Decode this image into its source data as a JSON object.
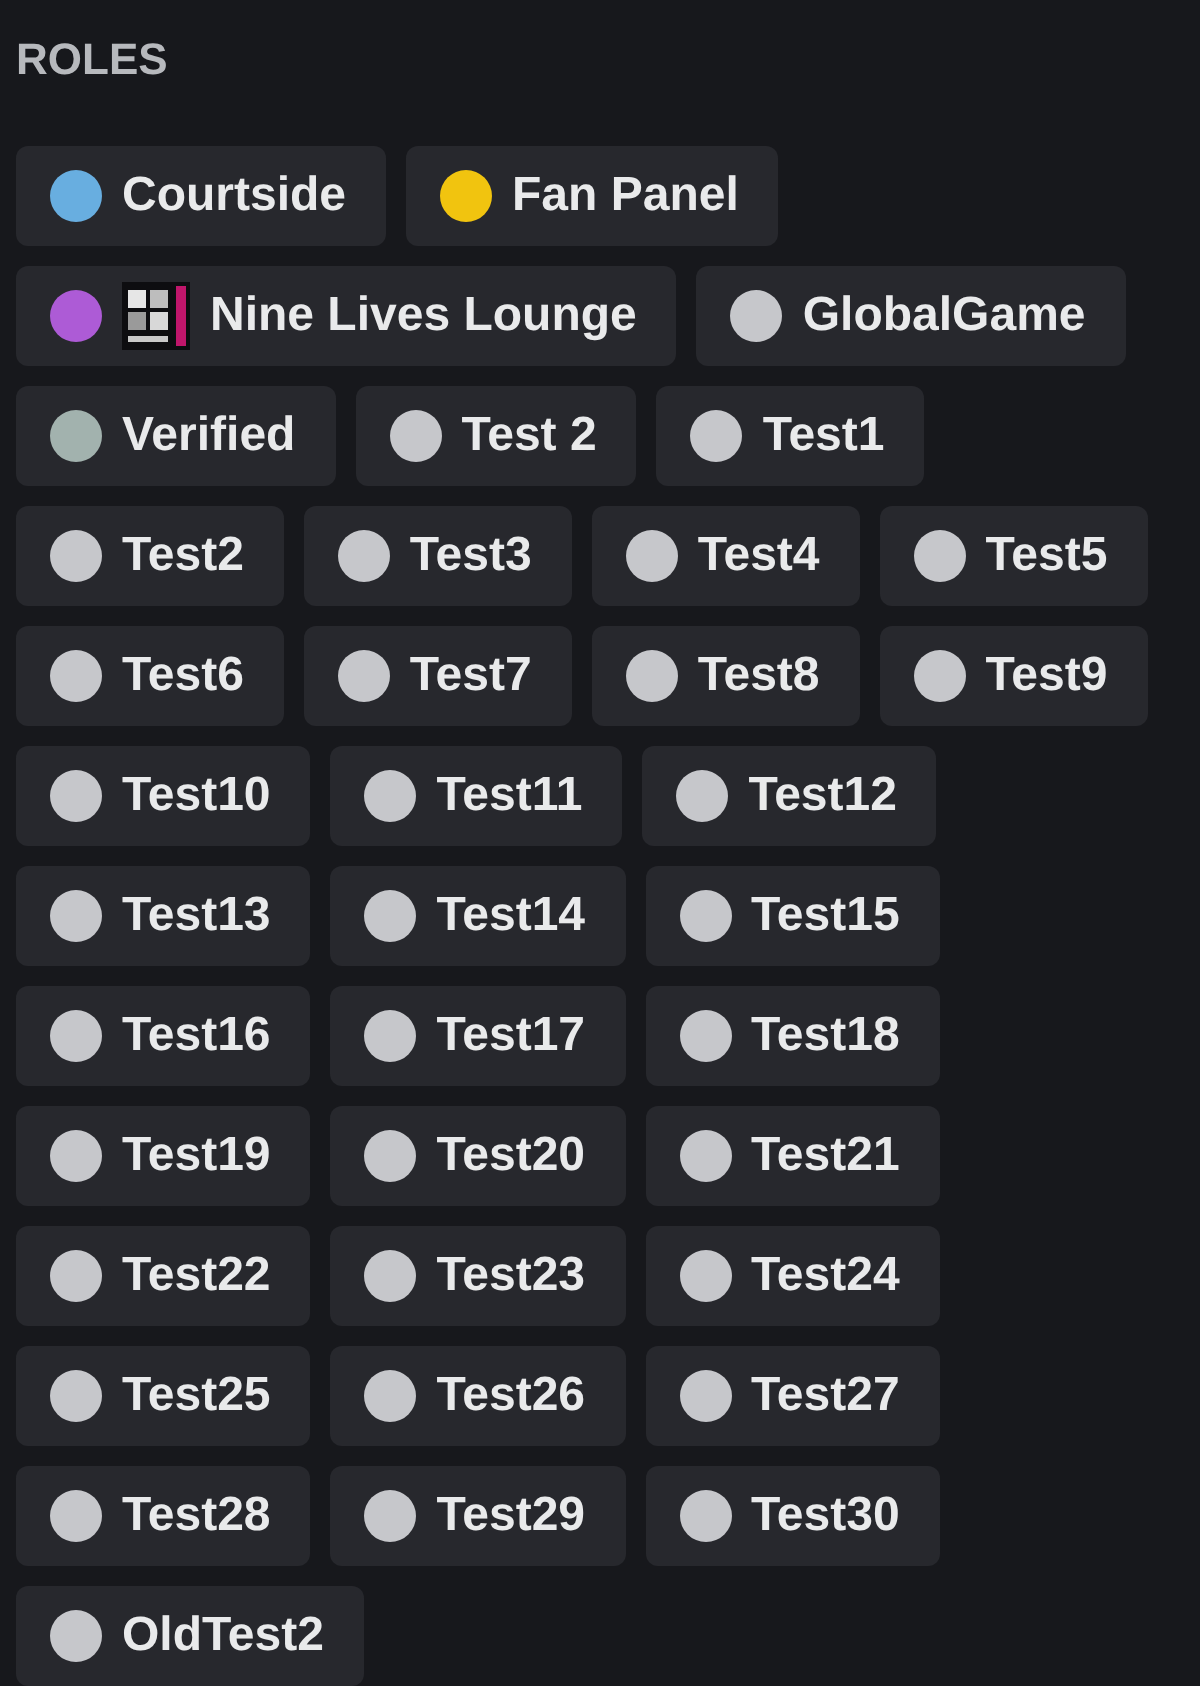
{
  "section": {
    "title": "ROLES"
  },
  "roles": [
    {
      "name": "Courtside",
      "color": "#68aee0",
      "kind": "dot"
    },
    {
      "name": "Fan Panel",
      "color": "#f1c40f",
      "kind": "dot"
    },
    {
      "name": "Nine Lives Lounge",
      "color": "#ad5bd6",
      "kind": "icon"
    },
    {
      "name": "GlobalGame",
      "color": "#c6c7cb",
      "kind": "dot"
    },
    {
      "name": "Verified",
      "color": "#a2b2ae",
      "kind": "dot"
    },
    {
      "name": "Test 2",
      "color": "#c6c7cb",
      "kind": "dot"
    },
    {
      "name": "Test1",
      "color": "#c6c7cb",
      "kind": "dot"
    },
    {
      "name": "Test2",
      "color": "#c6c7cb",
      "kind": "dot"
    },
    {
      "name": "Test3",
      "color": "#c6c7cb",
      "kind": "dot"
    },
    {
      "name": "Test4",
      "color": "#c6c7cb",
      "kind": "dot"
    },
    {
      "name": "Test5",
      "color": "#c6c7cb",
      "kind": "dot"
    },
    {
      "name": "Test6",
      "color": "#c6c7cb",
      "kind": "dot"
    },
    {
      "name": "Test7",
      "color": "#c6c7cb",
      "kind": "dot"
    },
    {
      "name": "Test8",
      "color": "#c6c7cb",
      "kind": "dot"
    },
    {
      "name": "Test9",
      "color": "#c6c7cb",
      "kind": "dot"
    },
    {
      "name": "Test10",
      "color": "#c6c7cb",
      "kind": "dot"
    },
    {
      "name": "Test11",
      "color": "#c6c7cb",
      "kind": "dot"
    },
    {
      "name": "Test12",
      "color": "#c6c7cb",
      "kind": "dot"
    },
    {
      "name": "Test13",
      "color": "#c6c7cb",
      "kind": "dot"
    },
    {
      "name": "Test14",
      "color": "#c6c7cb",
      "kind": "dot"
    },
    {
      "name": "Test15",
      "color": "#c6c7cb",
      "kind": "dot"
    },
    {
      "name": "Test16",
      "color": "#c6c7cb",
      "kind": "dot"
    },
    {
      "name": "Test17",
      "color": "#c6c7cb",
      "kind": "dot"
    },
    {
      "name": "Test18",
      "color": "#c6c7cb",
      "kind": "dot"
    },
    {
      "name": "Test19",
      "color": "#c6c7cb",
      "kind": "dot"
    },
    {
      "name": "Test20",
      "color": "#c6c7cb",
      "kind": "dot"
    },
    {
      "name": "Test21",
      "color": "#c6c7cb",
      "kind": "dot"
    },
    {
      "name": "Test22",
      "color": "#c6c7cb",
      "kind": "dot"
    },
    {
      "name": "Test23",
      "color": "#c6c7cb",
      "kind": "dot"
    },
    {
      "name": "Test24",
      "color": "#c6c7cb",
      "kind": "dot"
    },
    {
      "name": "Test25",
      "color": "#c6c7cb",
      "kind": "dot"
    },
    {
      "name": "Test26",
      "color": "#c6c7cb",
      "kind": "dot"
    },
    {
      "name": "Test27",
      "color": "#c6c7cb",
      "kind": "dot"
    },
    {
      "name": "Test28",
      "color": "#c6c7cb",
      "kind": "dot"
    },
    {
      "name": "Test29",
      "color": "#c6c7cb",
      "kind": "dot"
    },
    {
      "name": "Test30",
      "color": "#c6c7cb",
      "kind": "dot"
    },
    {
      "name": "OldTest2",
      "color": "#c6c7cb",
      "kind": "dot"
    }
  ]
}
